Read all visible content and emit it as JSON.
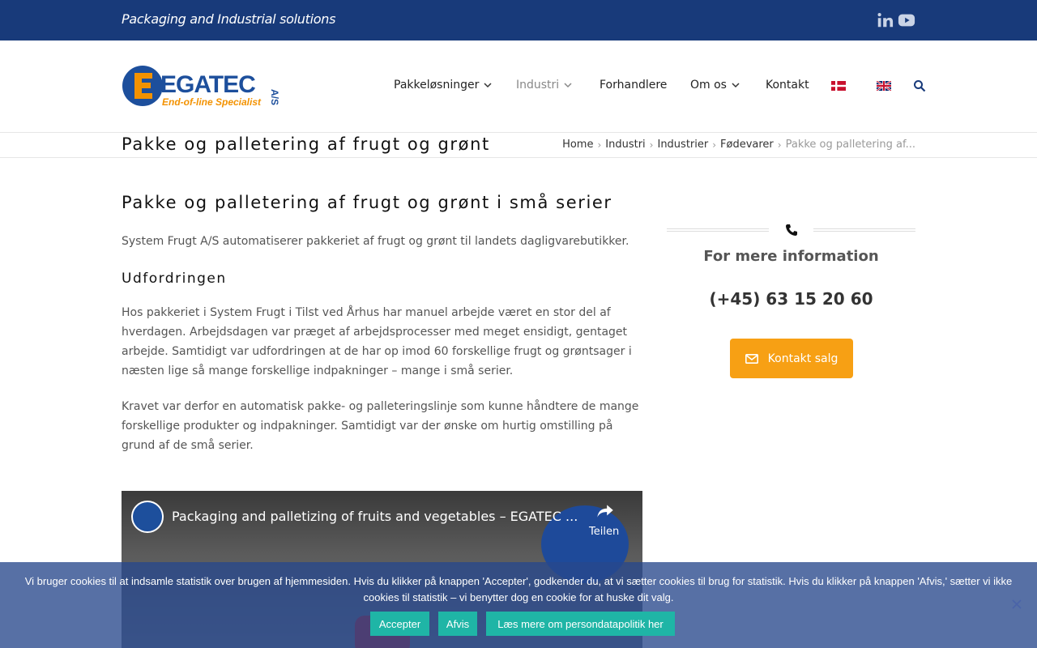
{
  "topbar": {
    "tagline": "Packaging and Industrial solutions",
    "icons": [
      "linkedin-icon",
      "youtube-icon"
    ]
  },
  "logo": {
    "brand": "EGATEC",
    "suffix": "A/S",
    "slogan": "End-of-line Specialist"
  },
  "nav": {
    "items": [
      {
        "label": "Pakkeløsninger",
        "dropdown": true
      },
      {
        "label": "Industri",
        "dropdown": true,
        "active": true
      },
      {
        "label": "Forhandlere",
        "dropdown": false
      },
      {
        "label": "Om os",
        "dropdown": true
      },
      {
        "label": "Kontakt",
        "dropdown": false
      }
    ],
    "languages": [
      "danish-flag-icon",
      "english-flag-icon"
    ]
  },
  "page_title": "Pakke og palletering af frugt og grønt",
  "breadcrumb": {
    "items": [
      "Home",
      "Industri",
      "Industrier",
      "Fødevarer"
    ],
    "current": "Pakke og palletering af..."
  },
  "content": {
    "heading": "Pakke og palletering af frugt og grønt i små serier",
    "intro": "System Frugt A/S automatiserer pakkeriet af frugt og grønt til landets dagligvarebutikker.",
    "subheading": "Udfordringen",
    "para1": "Hos pakkeriet i System Frugt i Tilst ved Århus har manuel arbejde været en stor del af hverdagen. Arbejdsdagen var præget af arbejdsprocesser med meget ensidigt, gentaget arbejde. Samtidigt var udfordringen at de har op imod 60 forskellige frugt og grøntsager i næsten lige så mange forskellige indpakninger – mange i små serier.",
    "para2": "Kravet var derfor en automatisk pakke- og palleteringslinje som kunne håndtere de mange forskellige produkter og indpakninger. Samtidigt var der ønske om hurtig omstilling på grund af de små serier."
  },
  "video": {
    "title": "Packaging and palletizing of fruits and vegetables – EGATEC ...",
    "share_label": "Teilen"
  },
  "sidebar": {
    "title": "For mere information",
    "phone": "(+45) 63 15 20 60",
    "button": "Kontakt salg"
  },
  "cookie": {
    "text": "Vi bruger cookies til at indsamle statistik over brugen af hjemmesiden. Hvis du klikker på knappen 'Accepter', godkender du, at vi sætter cookies til brug for statistik. Hvis du klikker på knappen 'Afvis,' sætter vi ikke cookies til statistik – vi benytter dog en cookie for at huske dit valg.",
    "accept": "Accepter",
    "decline": "Afvis",
    "policy": "Læs mere om persondatapolitik her"
  },
  "colors": {
    "topbar": "#183a7a",
    "accent": "#f7a014",
    "cookie_btn": "#1fb5a6"
  }
}
